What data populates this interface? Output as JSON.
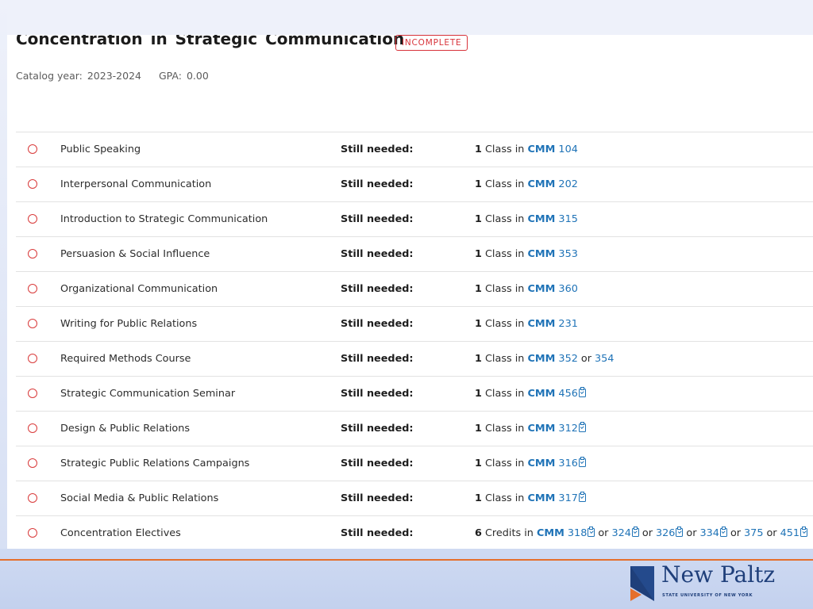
{
  "header": {
    "title": "Concentration in Strategic Communication",
    "status_badge": "INCOMPLETE",
    "catalog_year_label": "Catalog year:",
    "catalog_year": "2023-2024",
    "gpa_label": "GPA:",
    "gpa": "0.00"
  },
  "requirements": [
    {
      "name": "Public Speaking",
      "needed": "Still needed:",
      "count": "1",
      "unit": "Class in",
      "subject": "CMM",
      "courses": [
        {
          "num": "104",
          "clip": false
        }
      ]
    },
    {
      "name": "Interpersonal Communication",
      "needed": "Still needed:",
      "count": "1",
      "unit": "Class in",
      "subject": "CMM",
      "courses": [
        {
          "num": "202",
          "clip": false
        }
      ]
    },
    {
      "name": "Introduction to Strategic Communication",
      "needed": "Still needed:",
      "count": "1",
      "unit": "Class in",
      "subject": "CMM",
      "courses": [
        {
          "num": "315",
          "clip": false
        }
      ]
    },
    {
      "name": "Persuasion & Social Influence",
      "needed": "Still needed:",
      "count": "1",
      "unit": "Class in",
      "subject": "CMM",
      "courses": [
        {
          "num": "353",
          "clip": false
        }
      ]
    },
    {
      "name": "Organizational Communication",
      "needed": "Still needed:",
      "count": "1",
      "unit": "Class in",
      "subject": "CMM",
      "courses": [
        {
          "num": "360",
          "clip": false
        }
      ]
    },
    {
      "name": "Writing for Public Relations",
      "needed": "Still needed:",
      "count": "1",
      "unit": "Class in",
      "subject": "CMM",
      "courses": [
        {
          "num": "231",
          "clip": false
        }
      ]
    },
    {
      "name": "Required Methods Course",
      "needed": "Still needed:",
      "count": "1",
      "unit": "Class in",
      "subject": "CMM",
      "courses": [
        {
          "num": "352",
          "clip": false
        },
        {
          "num": "354",
          "clip": false
        }
      ]
    },
    {
      "name": "Strategic Communication Seminar",
      "needed": "Still needed:",
      "count": "1",
      "unit": "Class in",
      "subject": "CMM",
      "courses": [
        {
          "num": "456",
          "clip": true
        }
      ]
    },
    {
      "name": "Design & Public Relations",
      "needed": "Still needed:",
      "count": "1",
      "unit": "Class in",
      "subject": "CMM",
      "courses": [
        {
          "num": "312",
          "clip": true
        }
      ]
    },
    {
      "name": "Strategic Public Relations Campaigns",
      "needed": "Still needed:",
      "count": "1",
      "unit": "Class in",
      "subject": "CMM",
      "courses": [
        {
          "num": "316",
          "clip": true
        }
      ]
    },
    {
      "name": "Social Media & Public Relations",
      "needed": "Still needed:",
      "count": "1",
      "unit": "Class in",
      "subject": "CMM",
      "courses": [
        {
          "num": "317",
          "clip": true
        }
      ]
    },
    {
      "name": "Concentration Electives",
      "needed": "Still needed:",
      "count": "6",
      "unit": "Credits in",
      "subject": "CMM",
      "courses": [
        {
          "num": "318",
          "clip": true
        },
        {
          "num": "324",
          "clip": true
        },
        {
          "num": "326",
          "clip": true
        },
        {
          "num": "334",
          "clip": true
        },
        {
          "num": "375",
          "clip": false
        },
        {
          "num": "451",
          "clip": true
        }
      ]
    }
  ],
  "or_word": "or",
  "icons": {
    "status": "circle-outline-icon",
    "course_detail": "clipboard-check-icon"
  },
  "colors": {
    "incomplete": "#d8333a",
    "link": "#1f73b7",
    "accent": "#e56f2c",
    "brand": "#1f3f7a"
  },
  "logo": {
    "name": "New Paltz",
    "subtitle": "STATE UNIVERSITY OF NEW YORK"
  }
}
